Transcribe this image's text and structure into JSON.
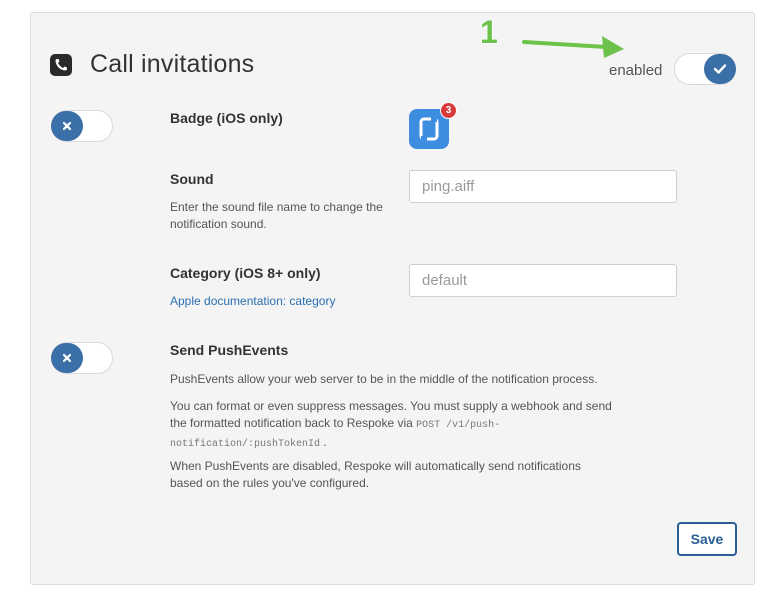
{
  "annotation": {
    "number": "1"
  },
  "header": {
    "title": "Call invitations",
    "enabled_label": "enabled",
    "enabled": true
  },
  "badge": {
    "label": "Badge (iOS only)",
    "enabled": false,
    "icon_count": "3"
  },
  "sound": {
    "label": "Sound",
    "help": "Enter the sound file name to change the notification sound.",
    "placeholder": "ping.aiff"
  },
  "category": {
    "label": "Category (iOS 8+ only)",
    "link": "Apple documentation: category",
    "placeholder": "default"
  },
  "push_events": {
    "label": "Send PushEvents",
    "enabled": false,
    "p1": "PushEvents allow your web server to be in the middle of the notification process.",
    "p2_a": "You can format or even suppress messages. You must supply a webhook and send the formatted notification back to Respoke via",
    "p2_code": "POST /v1/push-notification/:pushTokenId",
    "p2_end": ".",
    "p3": "When PushEvents are disabled, Respoke will automatically send notifications based on the rules you've configured."
  },
  "footer": {
    "save_label": "Save"
  },
  "colors": {
    "accent": "#3a6fa8",
    "annotation": "#6cc24a",
    "link": "#2a6fb0",
    "badge": "#d83a3a"
  }
}
